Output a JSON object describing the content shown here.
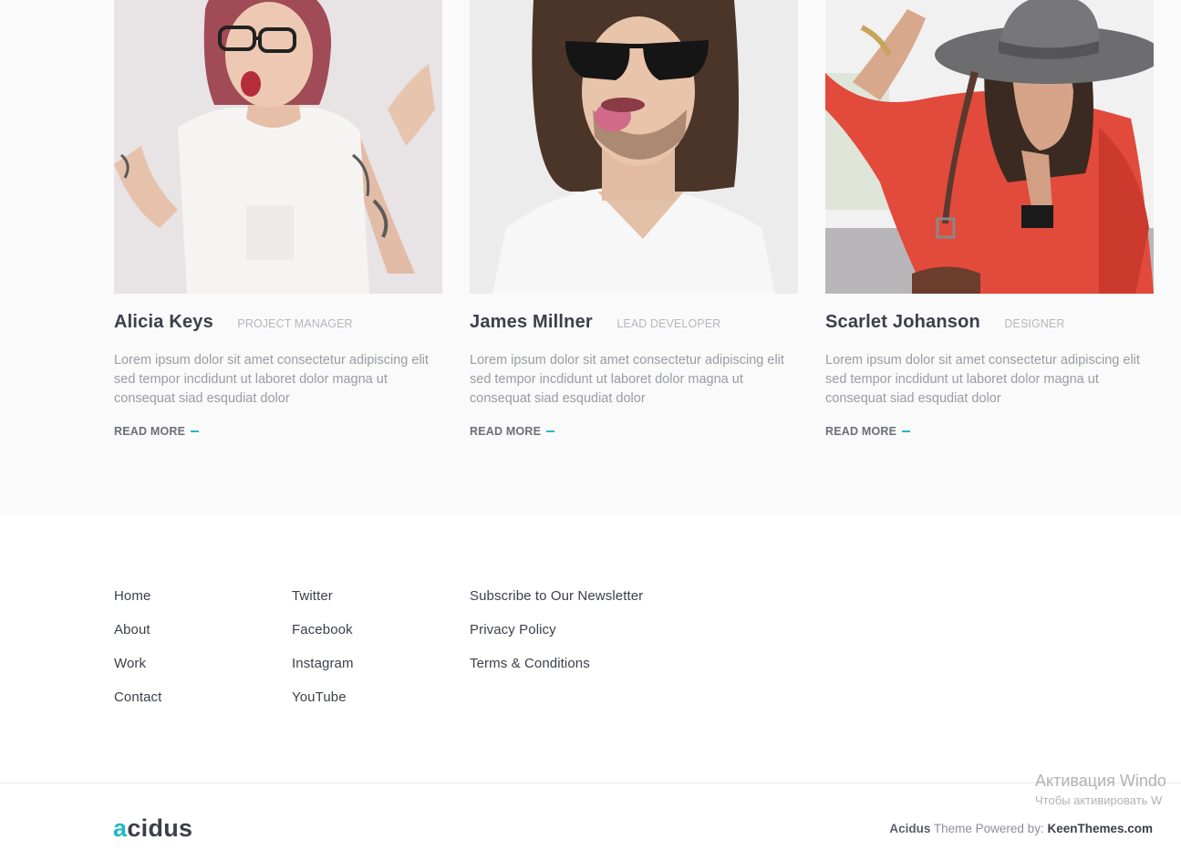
{
  "team": {
    "members": [
      {
        "name": "Alicia Keys",
        "role": "PROJECT MANAGER",
        "description": "Lorem ipsum dolor sit amet consectetur adipiscing elit sed tempor incdidunt ut laboret dolor magna ut consequat siad esqudiat dolor",
        "link_label": "READ MORE",
        "photo_bg": "#e9e4e6"
      },
      {
        "name": "James Millner",
        "role": "LEAD DEVELOPER",
        "description": "Lorem ipsum dolor sit amet consectetur adipiscing elit sed tempor incdidunt ut laboret dolor magna ut consequat siad esqudiat dolor",
        "link_label": "READ MORE",
        "photo_bg": "#ececec"
      },
      {
        "name": "Scarlet Johanson",
        "role": "DESIGNER",
        "description": "Lorem ipsum dolor sit amet consectetur adipiscing elit sed tempor incdidunt ut laboret dolor magna ut consequat siad esqudiat dolor",
        "link_label": "READ MORE",
        "photo_bg": "#f0f0f0"
      }
    ]
  },
  "footer": {
    "col1": [
      "Home",
      "About",
      "Work",
      "Contact"
    ],
    "col2": [
      "Twitter",
      "Facebook",
      "Instagram",
      "YouTube"
    ],
    "col3": [
      "Subscribe to Our Newsletter",
      "Privacy Policy",
      "Terms & Conditions"
    ]
  },
  "bottom": {
    "logo_accent": "a",
    "logo_rest": "cidus",
    "theme_name": "Acidus",
    "powered_text": " Theme Powered by: ",
    "powered_link": "KeenThemes.com"
  },
  "windows_overlay": {
    "title": "Активация Windo",
    "subtitle": "Чтобы активировать W"
  },
  "colors": {
    "accent": "#22b8c8",
    "heading": "#3c3f49",
    "muted": "#9a9ca3",
    "section_bg": "#fafafa"
  }
}
